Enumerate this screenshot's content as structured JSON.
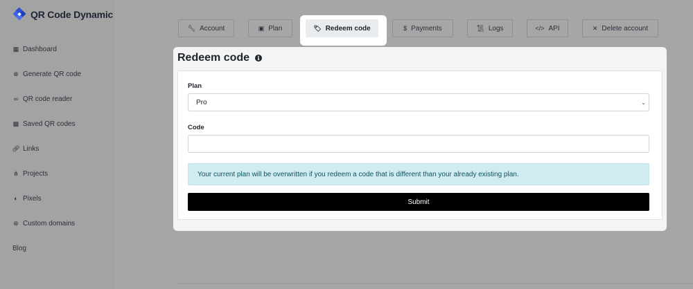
{
  "brand": {
    "name": "QR Code Dynamic",
    "icon": "qr-logo-icon"
  },
  "sidebar": {
    "items": [
      {
        "label": "Dashboard",
        "icon": "grid-icon"
      },
      {
        "label": "Generate QR code",
        "icon": "plus-circle-icon"
      },
      {
        "label": "QR code reader",
        "icon": "glasses-icon"
      },
      {
        "label": "Saved QR codes",
        "icon": "qrcode-icon"
      },
      {
        "label": "Links",
        "icon": "link-icon"
      },
      {
        "label": "Projects",
        "icon": "project-diagram-icon"
      },
      {
        "label": "Pixels",
        "icon": "adjust-icon"
      },
      {
        "label": "Custom domains",
        "icon": "globe-icon"
      }
    ],
    "blog": "Blog"
  },
  "tabs": [
    {
      "label": "Account",
      "icon": "wrench-icon"
    },
    {
      "label": "Plan",
      "icon": "box-icon"
    },
    {
      "label": "Redeem code",
      "icon": "tags-icon",
      "active": true
    },
    {
      "label": "Payments",
      "icon": "dollar-icon"
    },
    {
      "label": "Logs",
      "icon": "scroll-icon"
    },
    {
      "label": "API",
      "icon": "code-icon"
    },
    {
      "label": "Delete account",
      "icon": "times-icon"
    }
  ],
  "card": {
    "title": "Redeem code",
    "plan_label": "Plan",
    "plan_value": "Pro",
    "code_label": "Code",
    "code_value": "",
    "alert": "Your current plan will be overwritten if you redeem a code that is different than your already existing plan.",
    "submit": "Submit"
  },
  "colors": {
    "accent": "#000000",
    "alert_bg": "#d1ecf1",
    "alert_text": "#0c5460"
  }
}
